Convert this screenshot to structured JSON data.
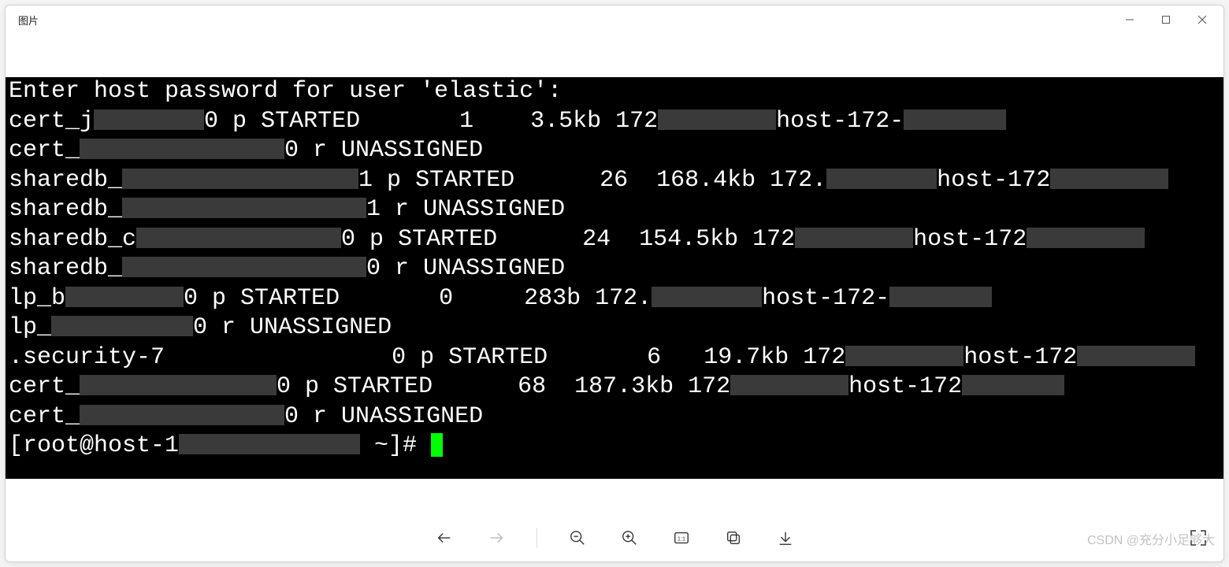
{
  "window": {
    "title": "图片"
  },
  "terminal": {
    "header": "Enter host password for user 'elastic':",
    "rows": [
      {
        "idx": "cert_j",
        "shard": "0",
        "pr": "p",
        "state": "STARTED",
        "docs": "1",
        "size": "3.5kb",
        "ip": "172",
        "dot": "",
        "host": "host-172-"
      },
      {
        "idx": "cert_",
        "shard": "0",
        "pr": "r",
        "state": "UNASSIGNED",
        "docs": "",
        "size": "",
        "ip": "",
        "dot": "",
        "host": ""
      },
      {
        "idx": "sharedb_",
        "shard": "1",
        "pr": "p",
        "state": "STARTED",
        "docs": "26",
        "size": "168.4kb",
        "ip": "172",
        "dot": ".",
        "host": "host-172"
      },
      {
        "idx": "sharedb_",
        "shard": "1",
        "pr": "r",
        "state": "UNASSIGNED",
        "docs": "",
        "size": "",
        "ip": "",
        "dot": "",
        "host": ""
      },
      {
        "idx": "sharedb_c",
        "shard": "0",
        "pr": "p",
        "state": "STARTED",
        "docs": "24",
        "size": "154.5kb",
        "ip": "172",
        "dot": "",
        "host": "host-172"
      },
      {
        "idx": "sharedb_",
        "shard": "0",
        "pr": "r",
        "state": "UNASSIGNED",
        "docs": "",
        "size": "",
        "ip": "",
        "dot": "",
        "host": ""
      },
      {
        "idx": "lp_b",
        "shard": "0",
        "pr": "p",
        "state": "STARTED",
        "docs": "0",
        "size": "283b",
        "ip": "172",
        "dot": ".",
        "host": "host-172-"
      },
      {
        "idx": "lp_",
        "shard": "0",
        "pr": "r",
        "state": "UNASSIGNED",
        "docs": "",
        "size": "",
        "ip": "",
        "dot": "",
        "host": ""
      },
      {
        "idx": ".security-7",
        "shard": "0",
        "pr": "p",
        "state": "STARTED",
        "docs": "6",
        "size": "19.7kb",
        "ip": "172",
        "dot": "",
        "host": "host-172"
      },
      {
        "idx": "cert_",
        "shard": "0",
        "pr": "p",
        "state": "STARTED",
        "docs": "68",
        "size": "187.3kb",
        "ip": "172",
        "dot": "",
        "host": "host-172"
      },
      {
        "idx": "cert_",
        "shard": "0",
        "pr": "r",
        "state": "UNASSIGNED",
        "docs": "",
        "size": "",
        "ip": "",
        "dot": "",
        "host": ""
      }
    ],
    "smudge_width": [
      140,
      260,
      300,
      310,
      260,
      310,
      150,
      180,
      0,
      250,
      260
    ],
    "ip_smudge_width": [
      150,
      0,
      140,
      0,
      150,
      0,
      140,
      0,
      150,
      150,
      0
    ],
    "host_smudge_width": [
      130,
      0,
      150,
      0,
      150,
      0,
      130,
      0,
      150,
      130,
      0
    ],
    "prompt_pre": "[root@host-1",
    "prompt_post": " ~]# "
  },
  "toolbar": {
    "prev": "Previous",
    "next": "Next",
    "zoom_out": "Zoom out",
    "zoom_in": "Zoom in",
    "actual": "1:1",
    "copy": "Copy",
    "save": "Save",
    "fullscreen": "Fullscreen"
  },
  "watermark": "CSDN @充分小足够大"
}
